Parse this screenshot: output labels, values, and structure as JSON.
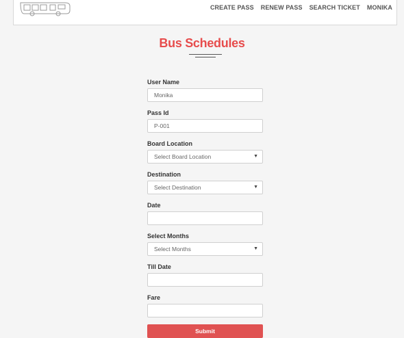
{
  "nav": {
    "links": [
      "CREATE PASS",
      "RENEW PASS",
      "SEARCH TICKET",
      "MONIKA"
    ]
  },
  "page": {
    "title": "Bus Schedules"
  },
  "form": {
    "user_name": {
      "label": "User Name",
      "value": "Monika"
    },
    "pass_id": {
      "label": "Pass Id",
      "value": "P-001"
    },
    "board_location": {
      "label": "Board Location",
      "selected": "Select Board Location"
    },
    "destination": {
      "label": "Destination",
      "selected": "Select Destination"
    },
    "date": {
      "label": "Date",
      "value": ""
    },
    "select_months": {
      "label": "Select Months",
      "selected": "Select Months"
    },
    "till_date": {
      "label": "Till Date",
      "value": ""
    },
    "fare": {
      "label": "Fare",
      "value": ""
    },
    "submit_label": "Submit"
  },
  "colors": {
    "accent": "#e74c4c",
    "button": "#e05252",
    "background": "#f5f5f5"
  }
}
